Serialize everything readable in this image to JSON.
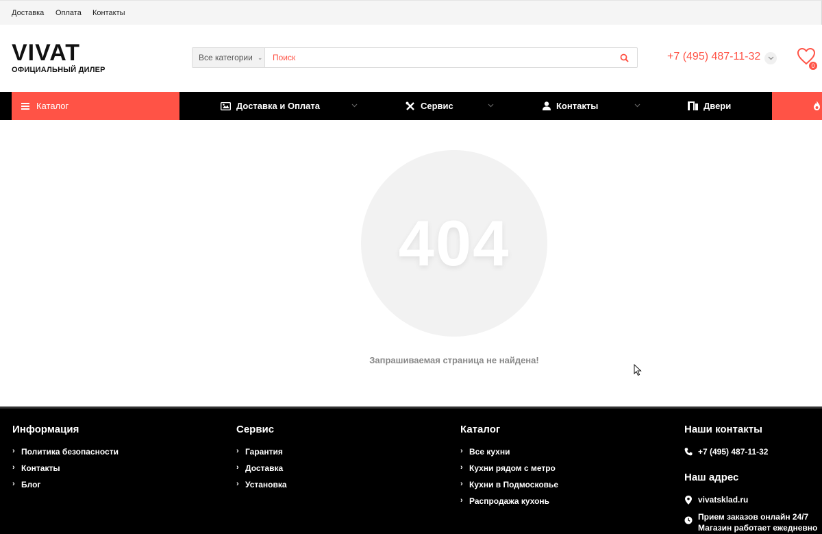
{
  "topbar": {
    "links": [
      "Доставка",
      "Оплата",
      "Контакты"
    ]
  },
  "logo": {
    "mark": "VIVAT",
    "subtitle": "ОФИЦИАЛЬНЫЙ ДИЛЕР"
  },
  "search": {
    "category": "Все категории",
    "placeholder": "Поиск"
  },
  "phone": "+7 (495) 487-11-32",
  "favorites_count": "0",
  "nav": {
    "catalog": "Каталог",
    "items": [
      "Доставка и Оплата",
      "Сервис",
      "Контакты",
      "Двери"
    ]
  },
  "error": {
    "code": "404",
    "message": "Запрашиваемая страница не найдена!"
  },
  "footer": {
    "info": {
      "title": "Информация",
      "links": [
        "Политика безопасности",
        "Контакты",
        "Блог"
      ]
    },
    "service": {
      "title": "Сервис",
      "links": [
        "Гарантия",
        "Доставка",
        "Установка"
      ]
    },
    "catalog": {
      "title": "Каталог",
      "links": [
        "Все кухни",
        "Кухни рядом с метро",
        "Кухни в Подмосковье",
        "Распродажа кухонь"
      ]
    },
    "contacts": {
      "title": "Наши контакты",
      "phone": "+7 (495) 487-11-32",
      "address_title": "Наш адрес",
      "site": "vivatsklad.ru",
      "hours_1": "Прием заказов онлайн 24/7",
      "hours_2": "Магазин работает ежедневно"
    }
  },
  "colors": {
    "accent": "#ff5346",
    "nav_bg": "#000000",
    "footer_bg": "#000000"
  }
}
